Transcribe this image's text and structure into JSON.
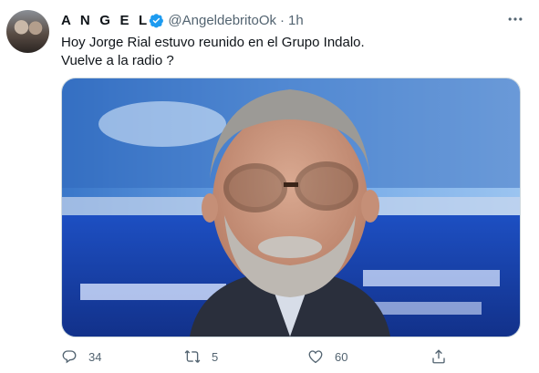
{
  "tweet": {
    "name": "A N G E L",
    "handle": "@AngeldebritoOk",
    "separator": "·",
    "time": "1h",
    "text_lines": [
      "Hoy Jorge Rial estuvo reunido en el Grupo Indalo.",
      "Vuelve a la radio ?"
    ],
    "media_description": "Photo of a bearded man with glasses in a TV studio"
  },
  "actions": {
    "reply_count": "34",
    "retweet_count": "5",
    "like_count": "60"
  },
  "icons": [
    "verified-icon",
    "more-icon",
    "reply-icon",
    "retweet-icon",
    "like-icon",
    "share-icon"
  ],
  "colors": {
    "verified": "#1d9bf0",
    "secondary_text": "#536471"
  }
}
